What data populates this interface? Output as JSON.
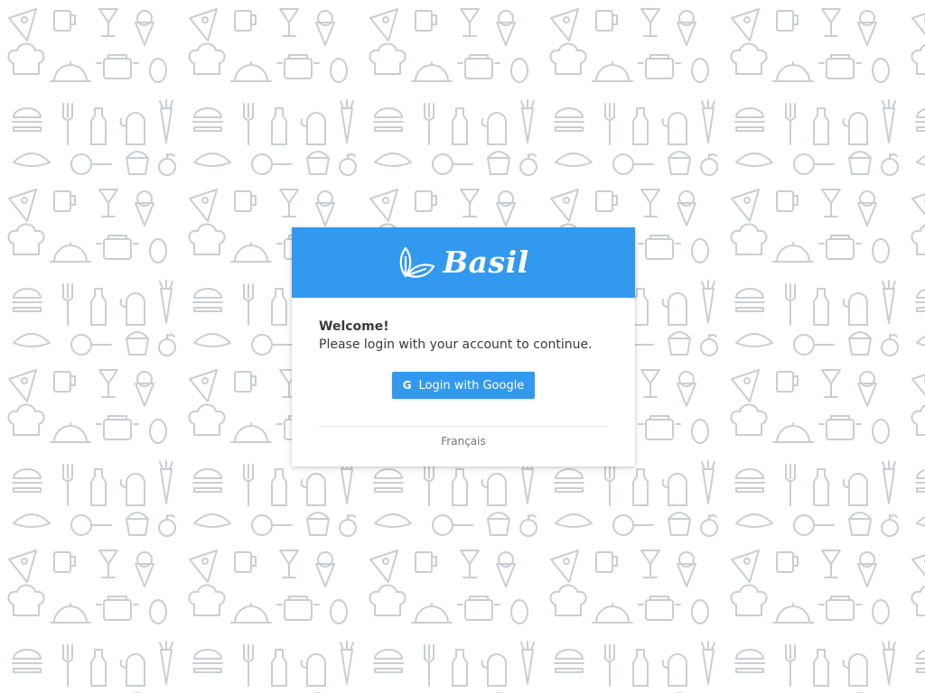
{
  "brand": {
    "name": "Basil",
    "logo_icon": "basil-leaf-icon",
    "header_color": "#3399ee"
  },
  "welcome": {
    "title": "Welcome!",
    "message": "Please login with your account to continue."
  },
  "login": {
    "google_icon": "G",
    "google_label": "Login with Google",
    "button_color": "#3399ee"
  },
  "footer": {
    "language_link": "Français"
  },
  "background": {
    "pattern": "food-doodle-pattern",
    "doodle_color": "#c9ced3"
  }
}
